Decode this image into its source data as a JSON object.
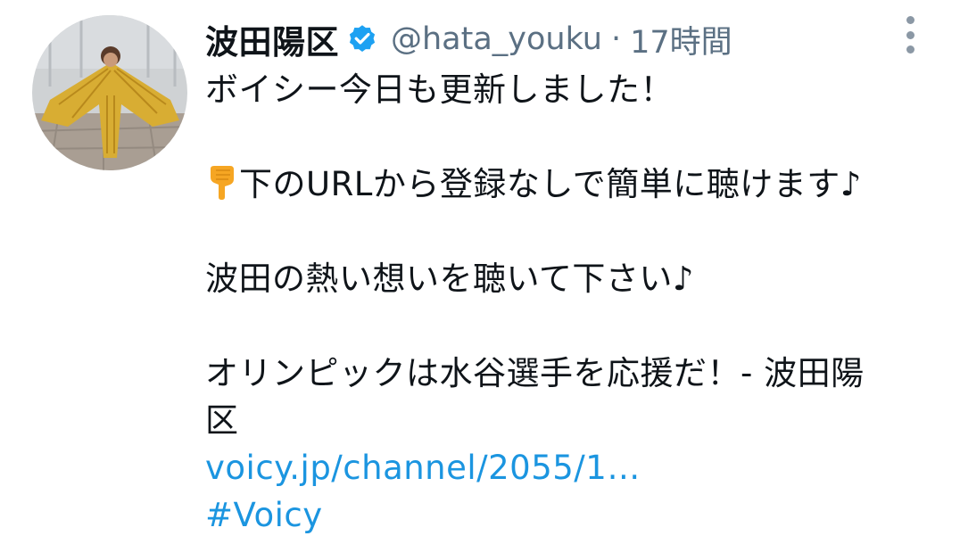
{
  "tweet": {
    "display_name": "波田陽区",
    "handle": "@hata_youku",
    "separator": "·",
    "time": "17時間",
    "lines": {
      "l1": "ボイシー今日も更新しました！",
      "l2": "下のURLから登録なしで簡単に聴けます♪",
      "l3": "波田の熱い想いを聴いて下さい♪",
      "l4a": "オリンピックは水谷選手を応援だ！- 波田陽",
      "l4b": "区"
    },
    "link": "voicy.jp/channel/2055/1…",
    "hashtag": "#Voicy",
    "emoji": "pointing-down-hand",
    "verified": true
  },
  "colors": {
    "text": "#0f1419",
    "secondary": "#5b7083",
    "link": "#1b95e0",
    "verified": "#1da1f2"
  },
  "icons": {
    "verified": "verified-badge-icon",
    "more": "more-options-icon",
    "emoji": "pointing-down-emoji-icon"
  }
}
